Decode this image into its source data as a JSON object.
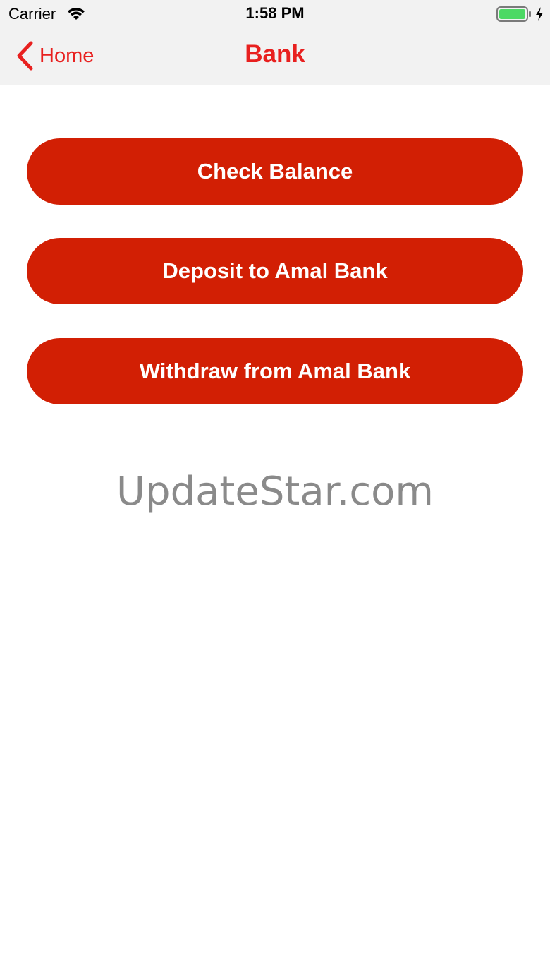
{
  "status_bar": {
    "carrier": "Carrier",
    "time": "1:58 PM",
    "wifi_icon": "wifi-icon",
    "battery_icon": "battery-full-icon",
    "charging_icon": "charging-bolt-icon"
  },
  "nav": {
    "back_label": "Home",
    "back_icon": "chevron-left-icon",
    "title": "Bank"
  },
  "actions": [
    {
      "label": "Check Balance"
    },
    {
      "label": "Deposit to Amal Bank"
    },
    {
      "label": "Withdraw from Amal Bank"
    }
  ],
  "watermark": "UpdateStar.com",
  "colors": {
    "accent": "#e8201f",
    "button_bg": "#d21f04",
    "button_text": "#ffffff",
    "header_bg": "#f2f2f2",
    "battery_fill": "#4cd964",
    "watermark": "#8a8a8a"
  }
}
